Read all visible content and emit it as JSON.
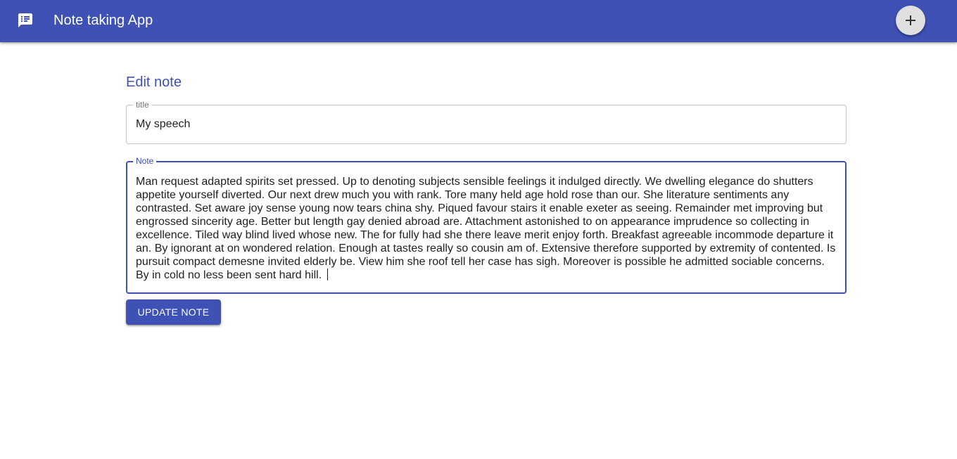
{
  "appbar": {
    "title": "Note taking App",
    "app_icon": "chat-message-icon",
    "add_icon": "plus-icon",
    "color": "#3f51b5"
  },
  "editor": {
    "heading": "Edit note",
    "title_field": {
      "label": "title",
      "value": "My speech"
    },
    "note_field": {
      "label": "Note",
      "value": "Man request adapted spirits set pressed. Up to denoting subjects sensible feelings it indulged directly. We dwelling elegance do shutters appetite yourself diverted. Our next drew much you with rank. Tore many held age hold rose than our. She literature sentiments any contrasted. Set aware joy sense young now tears china shy.   Piqued favour stairs it enable exeter as seeing. Remainder met improving but engrossed sincerity age. Better but length gay denied abroad are. Attachment astonished to on appearance imprudence so collecting in excellence. Tiled way blind lived whose new. The for fully had she there leave merit enjoy forth.   Breakfast agreeable incommode departure it an. By ignorant at on wondered relation. Enough at tastes really so cousin am of. Extensive therefore supported by extremity of contented. Is pursuit compact demesne invited elderly be. View him she roof tell her case has sigh. Moreover is possible he admitted sociable concerns. By in cold no less been sent hard hill. "
    },
    "submit_label": "UPDATE NOTE"
  }
}
